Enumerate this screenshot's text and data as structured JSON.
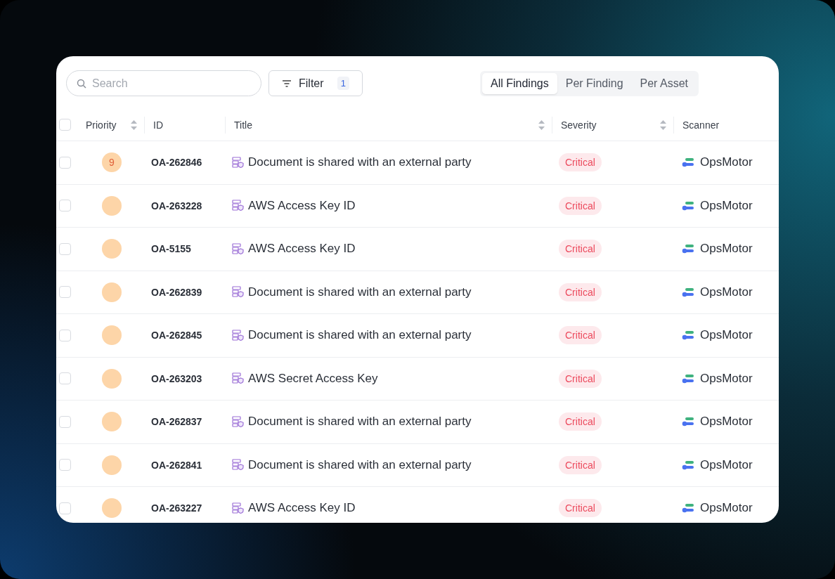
{
  "search": {
    "placeholder": "Search"
  },
  "filter": {
    "label": "Filter",
    "count": "1"
  },
  "tabs": [
    {
      "label": "All Findings",
      "selected": true
    },
    {
      "label": "Per Finding",
      "selected": false
    },
    {
      "label": "Per Asset",
      "selected": false
    }
  ],
  "table": {
    "select_all": {
      "checked": false
    },
    "columns": [
      {
        "label": "Priority",
        "sortable": true
      },
      {
        "label": "ID",
        "sortable": false
      },
      {
        "label": "Title",
        "sortable": true
      },
      {
        "label": "Severity",
        "sortable": true
      },
      {
        "label": "Scanner",
        "sortable": false
      }
    ],
    "rows": [
      {
        "checked": false,
        "priority": "9",
        "id": "OA-262846",
        "title": "Document is shared with an external party",
        "severity": "Critical",
        "scanner": "OpsMotor"
      },
      {
        "checked": false,
        "id": "OA-263228",
        "title": "AWS Access Key ID",
        "severity": "Critical",
        "scanner": "OpsMotor"
      },
      {
        "checked": false,
        "id": "OA-5155",
        "title": "AWS Access Key ID",
        "severity": "Critical",
        "scanner": "OpsMotor"
      },
      {
        "checked": false,
        "id": "OA-262839",
        "title": "Document is shared with an external party",
        "severity": "Critical",
        "scanner": "OpsMotor"
      },
      {
        "checked": false,
        "id": "OA-262845",
        "title": "Document is shared with an external party",
        "severity": "Critical",
        "scanner": "OpsMotor"
      },
      {
        "checked": false,
        "id": "OA-263203",
        "title": "AWS Secret Access Key",
        "severity": "Critical",
        "scanner": "OpsMotor"
      },
      {
        "checked": false,
        "id": "OA-262837",
        "title": "Document is shared with an external party",
        "severity": "Critical",
        "scanner": "OpsMotor"
      },
      {
        "checked": false,
        "id": "OA-262841",
        "title": "Document is shared with an external party",
        "severity": "Critical",
        "scanner": "OpsMotor"
      },
      {
        "checked": false,
        "id": "OA-263227",
        "title": "AWS Access Key ID",
        "severity": "Critical",
        "scanner": "OpsMotor"
      }
    ]
  }
}
